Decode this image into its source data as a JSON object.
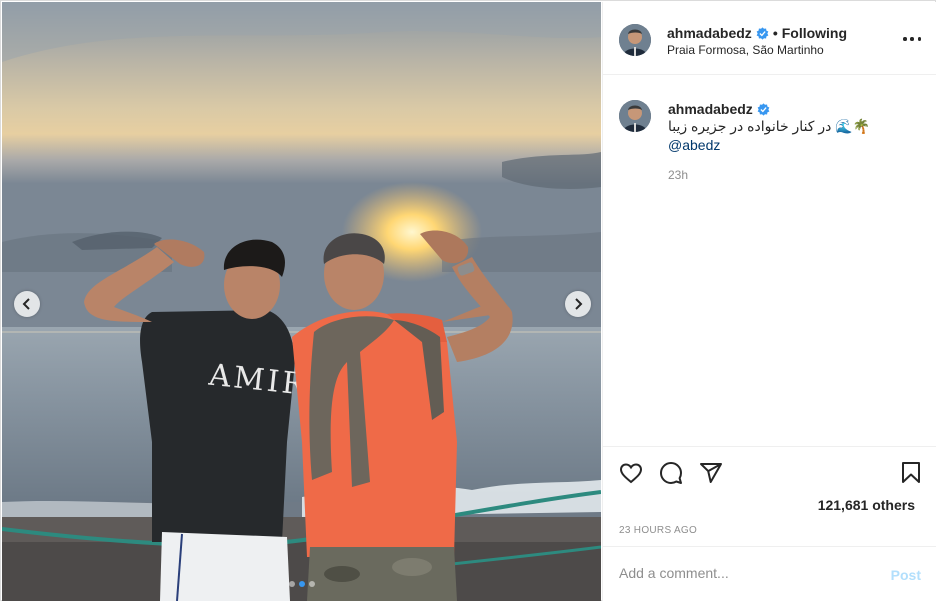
{
  "post": {
    "username": "ahmadabedz",
    "following_label": "Following",
    "bullet": "•",
    "location": "Praia Formosa, São Martinho",
    "more_icon": "more-horizontal-icon"
  },
  "caption": {
    "username": "ahmadabedz",
    "text": "در کنار خانواده در جزیره زیبا 🌊🌴",
    "mention": "@abedz",
    "time": "23h"
  },
  "actions": {
    "like_icon": "heart-icon",
    "comment_icon": "comment-icon",
    "share_icon": "paper-plane-icon",
    "save_icon": "bookmark-icon",
    "likes": "121,681 others",
    "age": "23 HOURS AGO"
  },
  "composer": {
    "placeholder": "Add a comment...",
    "post_label": "Post"
  },
  "carousel": {
    "slide_count": 3,
    "active_slide": 2
  },
  "colors": {
    "verified": "#3897f0",
    "link": "#00376b",
    "post_disabled": "#b2dffc",
    "muted": "#8e8e8e"
  }
}
